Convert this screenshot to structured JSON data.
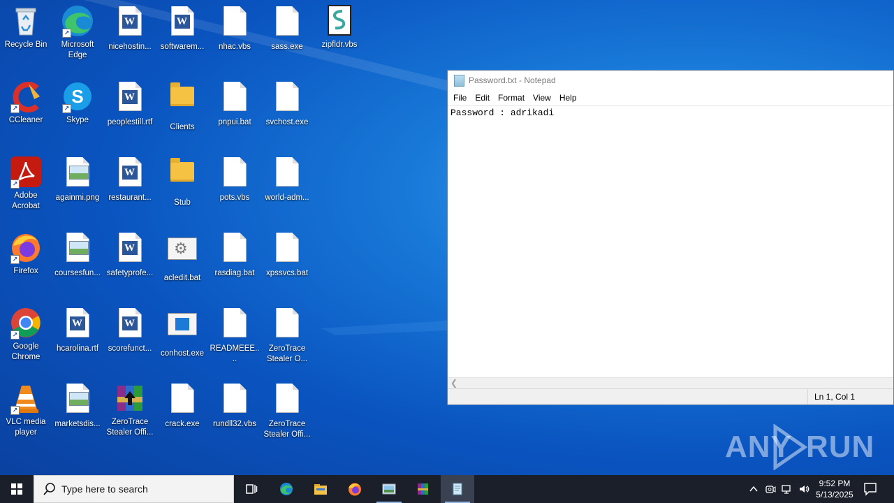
{
  "desktop": {
    "icons": [
      {
        "label": "Recycle Bin"
      },
      {
        "label": "Microsoft Edge"
      },
      {
        "label": "nicehostin..."
      },
      {
        "label": "softwarem..."
      },
      {
        "label": "nhac.vbs"
      },
      {
        "label": "sass.exe"
      },
      {
        "label": "zipfldr.vbs"
      },
      {
        "label": "CCleaner"
      },
      {
        "label": "Skype"
      },
      {
        "label": "peoplestill.rtf"
      },
      {
        "label": "Clients"
      },
      {
        "label": "pnpui.bat"
      },
      {
        "label": "svchost.exe"
      },
      {
        "label": "Adobe Acrobat"
      },
      {
        "label": "againmi.png"
      },
      {
        "label": "restaurant..."
      },
      {
        "label": "Stub"
      },
      {
        "label": "pots.vbs"
      },
      {
        "label": "world-adm..."
      },
      {
        "label": "Firefox"
      },
      {
        "label": "coursesfun..."
      },
      {
        "label": "safetyprofe..."
      },
      {
        "label": "acledit.bat"
      },
      {
        "label": "rasdiag.bat"
      },
      {
        "label": "xpssvcs.bat"
      },
      {
        "label": "Google Chrome"
      },
      {
        "label": "hcarolina.rtf"
      },
      {
        "label": "scorefunct..."
      },
      {
        "label": "conhost.exe"
      },
      {
        "label": "READMEEE...."
      },
      {
        "label": "ZeroTrace Stealer O..."
      },
      {
        "label": "VLC media player"
      },
      {
        "label": "marketsdis..."
      },
      {
        "label": "ZeroTrace Stealer Offi..."
      },
      {
        "label": "crack.exe"
      },
      {
        "label": "rundll32.vbs"
      },
      {
        "label": "ZeroTrace Stealer Offi..."
      }
    ]
  },
  "notepad": {
    "title": "Password.txt - Notepad",
    "menu": [
      "File",
      "Edit",
      "Format",
      "View",
      "Help"
    ],
    "content": "Password : adrikadi",
    "status_position": "Ln 1, Col 1"
  },
  "watermark": {
    "left": "ANY",
    "right": "RUN"
  },
  "taskbar": {
    "search_placeholder": "Type here to search",
    "pinned": [
      "task-view-icon",
      "edge-icon",
      "file-explorer-icon",
      "firefox-icon",
      "image-viewer-icon",
      "winrar-icon",
      "notepad-icon"
    ],
    "clock_time": "9:52 PM",
    "clock_date": "5/13/2025"
  },
  "colors": {
    "desktop_blue": "#0a54c0",
    "taskbar": "#1a1f29",
    "word_blue": "#2b579a",
    "folder_yellow": "#f6c244"
  }
}
